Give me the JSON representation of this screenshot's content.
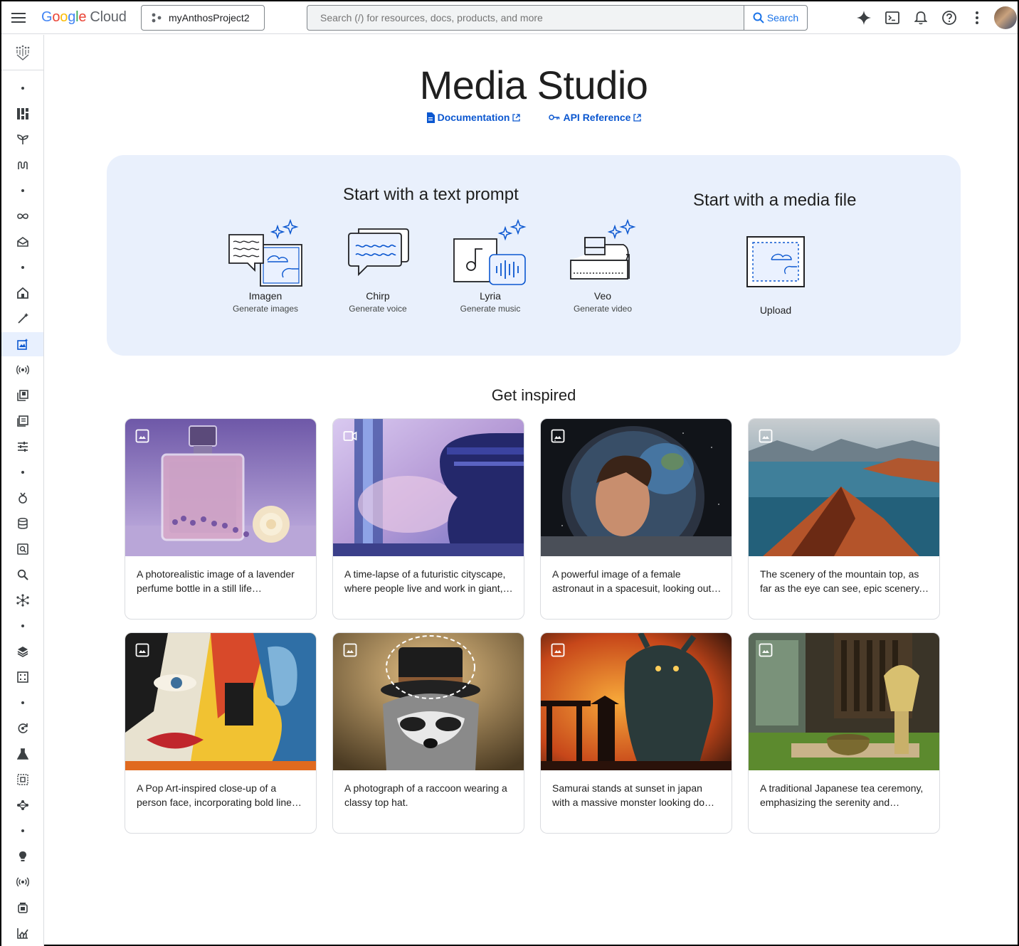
{
  "header": {
    "logo": {
      "g1": "G",
      "g2": "o",
      "g3": "o",
      "g4": "g",
      "g5": "l",
      "g6": "e",
      "cloud": "Cloud"
    },
    "project": "myAnthosProject2",
    "search_placeholder": "Search (/) for resources, docs, products, and more",
    "search_button": "Search"
  },
  "page": {
    "title": "Media Studio",
    "links": {
      "documentation": "Documentation",
      "api_reference": "API Reference"
    }
  },
  "panel": {
    "text_heading": "Start with a text prompt",
    "media_heading": "Start with a media file",
    "tools": [
      {
        "name": "Imagen",
        "sub": "Generate images"
      },
      {
        "name": "Chirp",
        "sub": "Generate voice"
      },
      {
        "name": "Lyria",
        "sub": "Generate music"
      },
      {
        "name": "Veo",
        "sub": "Generate video"
      }
    ],
    "upload": "Upload"
  },
  "inspired": {
    "heading": "Get inspired",
    "cards": [
      {
        "caption": "A photorealistic image of a lavender perfume bottle in a still life composition",
        "type": "image"
      },
      {
        "caption": "A time-lapse of a futuristic cityscape, where people live and work in giant, towering structures",
        "type": "video"
      },
      {
        "caption": "A powerful image of a female astronaut in a spacesuit, looking out into space",
        "type": "image"
      },
      {
        "caption": "The scenery of the mountain top, as far as the eye can see, epic scenery, lakes below",
        "type": "image"
      },
      {
        "caption": "A Pop Art-inspired close-up of a person face, incorporating bold lines and colors",
        "type": "image"
      },
      {
        "caption": "A photograph of a raccoon wearing a classy top hat.",
        "type": "image"
      },
      {
        "caption": "Samurai stands at sunset in japan with a massive monster looking down on him",
        "type": "image"
      },
      {
        "caption": "A traditional Japanese tea ceremony, emphasizing the serenity and elegance",
        "type": "image"
      }
    ]
  },
  "colors": {
    "accent": "#0b57d0",
    "panel_bg": "#e9f0fc",
    "rail_active": "#e8f0fe"
  }
}
